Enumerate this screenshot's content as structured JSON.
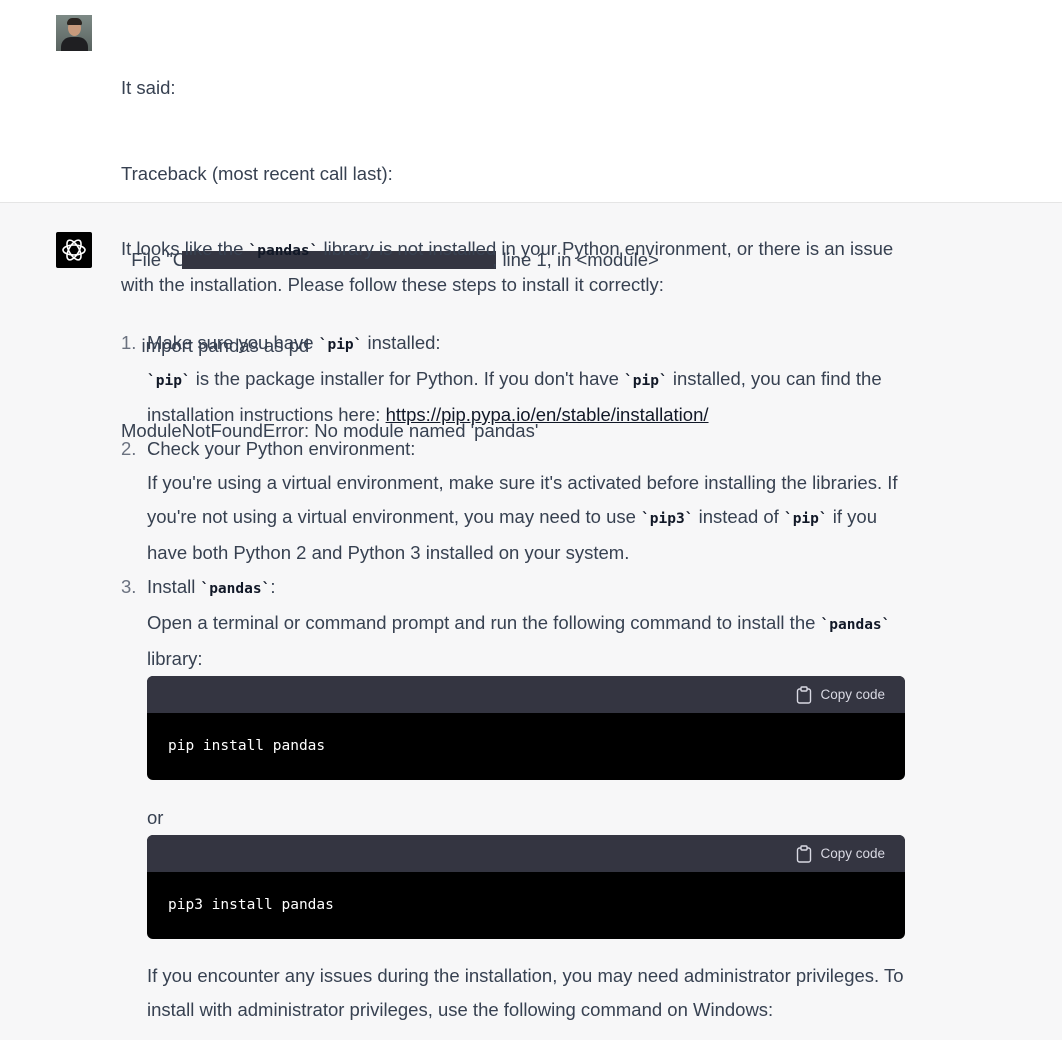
{
  "user_message": {
    "lines": [
      "It said:",
      "Traceback (most recent call last):",
      "  File \"C",
      ", line 1, in <module>",
      "    import pandas as pd",
      "ModuleNotFoundError: No module named 'pandas'"
    ]
  },
  "answer": {
    "intro_1": "It looks like the ",
    "intro_code": "`pandas`",
    "intro_2": " library is not installed in your Python environment, or there is an issue with the installation. Please follow these steps to install it correctly:",
    "steps": [
      {
        "num": "1.",
        "title_1": "Make sure you have ",
        "title_code": "`pip`",
        "title_2": " installed:",
        "body_code_a": "`pip`",
        "body_1": " is the package installer for Python. If you don't have ",
        "body_code_b": "`pip`",
        "body_2": " installed, you can find the installation instructions here: ",
        "link": "https://pip.pypa.io/en/stable/installation/"
      },
      {
        "num": "2.",
        "title": "Check your Python environment:",
        "body_1": "If you're using a virtual environment, make sure it's activated before installing the libraries. If you're not using a virtual environment, you may need to use ",
        "body_code_a": "`pip3`",
        "body_2": " instead of ",
        "body_code_b": "`pip`",
        "body_3": " if you have both Python 2 and Python 3 installed on your system."
      },
      {
        "num": "3.",
        "title_1": "Install ",
        "title_code": "`pandas`",
        "title_2": ":",
        "body_1": "Open a terminal or command prompt and run the following command to install the ",
        "body_code": "`pandas`",
        "body_2": " library:",
        "code_1": "pip install pandas",
        "or": "or",
        "code_2": "pip3 install pandas",
        "after": "If you encounter any issues during the installation, you may need administrator privileges. To install with administrator privileges, use the following command on Windows:"
      }
    ],
    "copy_label": "Copy code"
  },
  "icons": {
    "avatar": "user-avatar",
    "assistant": "openai-logo-icon",
    "copy": "clipboard-icon"
  }
}
